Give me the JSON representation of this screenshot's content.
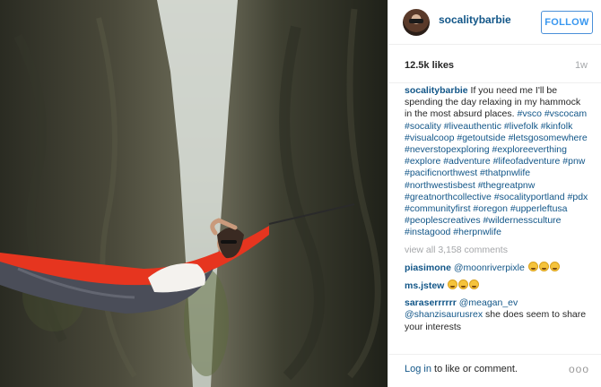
{
  "header": {
    "username": "socalitybarbie",
    "follow_label": "FOLLOW"
  },
  "stats": {
    "likes": "12.5k likes",
    "time_ago": "1w"
  },
  "caption": {
    "username": "socalitybarbie",
    "text": "If you need me I'll be spending the day relaxing in my hammock in the most absurd places.",
    "hashtags": "#vsco #vscocam #socality #liveauthentic #livefolk #kinfolk #visualcoop #getoutside #letsgosomewhere #neverstopexploring #exploreeverthing #explore #adventure #lifeofadventure #pnw #pacificnorthwest #thatpnwlife #northwestisbest #thegreatpnw #greatnorthcollective #socalityportland #pdx #communityfirst #oregon #upperleftusa #peoplescreatives #wildernessculture #instagood #herpnwlife"
  },
  "view_all": "view all 3,158 comments",
  "comments": [
    {
      "user": "piasimone",
      "mention": "@moonriverpixle",
      "text": "",
      "emoji_count": 3
    },
    {
      "user": "ms.jstew",
      "mention": "",
      "text": "",
      "emoji_count": 3
    },
    {
      "user": "saraserrrrrr",
      "mention": "@meagan_ev @shanzisaurusrex",
      "text": "she does seem to share your interests"
    }
  ],
  "footer": {
    "login_link": "Log in",
    "login_rest": " to like or comment.",
    "more_label": "ooo"
  },
  "photo": {
    "description_icon": "hammock-canyon-photo"
  }
}
